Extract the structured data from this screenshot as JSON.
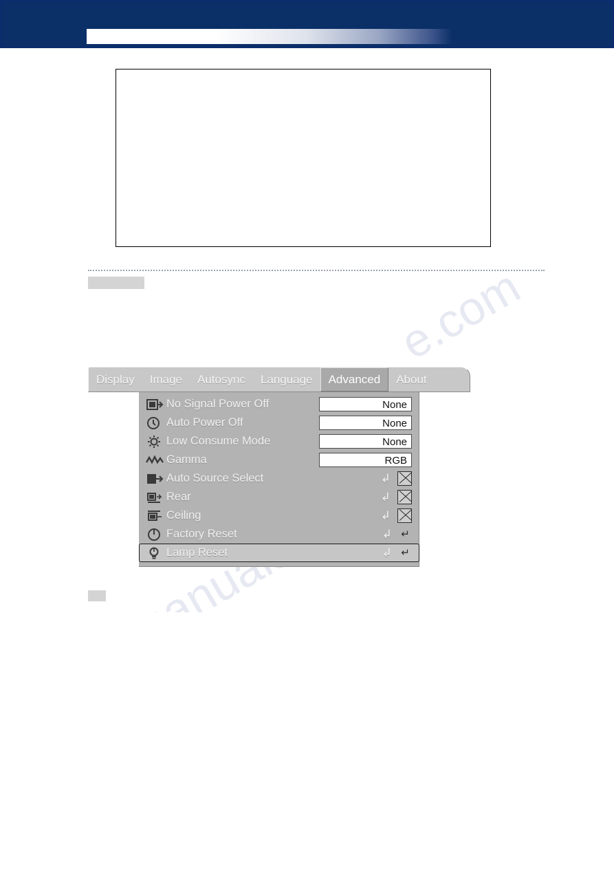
{
  "header": {
    "band_color": "#0b3068"
  },
  "watermark": {
    "line1": "e.com",
    "line2": "manualshive"
  },
  "osd": {
    "tabs": [
      {
        "label": "Display",
        "selected": false
      },
      {
        "label": "Image",
        "selected": false
      },
      {
        "label": "Autosync",
        "selected": false
      },
      {
        "label": "Language",
        "selected": false
      },
      {
        "label": "Advanced",
        "selected": true
      },
      {
        "label": "About",
        "selected": false
      }
    ],
    "rows": [
      {
        "icon": "no-signal-power-off-icon",
        "label": "No Signal Power Off",
        "type": "value",
        "value": "None",
        "highlight": false
      },
      {
        "icon": "auto-power-off-icon",
        "label": "Auto Power Off",
        "type": "value",
        "value": "None",
        "highlight": false
      },
      {
        "icon": "low-consume-mode-icon",
        "label": "Low Consume Mode",
        "type": "value",
        "value": "None",
        "highlight": false
      },
      {
        "icon": "gamma-icon",
        "label": "Gamma",
        "type": "value",
        "value": "RGB",
        "highlight": false
      },
      {
        "icon": "auto-source-select-icon",
        "label": "Auto Source Select",
        "type": "enter-check",
        "enter": "↲",
        "highlight": false
      },
      {
        "icon": "rear-icon",
        "label": "Rear",
        "type": "enter-check",
        "enter": "↲",
        "highlight": false
      },
      {
        "icon": "ceiling-icon",
        "label": "Ceiling",
        "type": "enter-check",
        "enter": "↲",
        "highlight": false
      },
      {
        "icon": "factory-reset-icon",
        "label": "Factory Reset",
        "type": "enter-return",
        "enter": "↲",
        "return": "↵",
        "highlight": false
      },
      {
        "icon": "lamp-reset-icon",
        "label": "Lamp Reset",
        "type": "enter-return",
        "enter": "↲",
        "return": "↵",
        "highlight": true
      }
    ]
  }
}
